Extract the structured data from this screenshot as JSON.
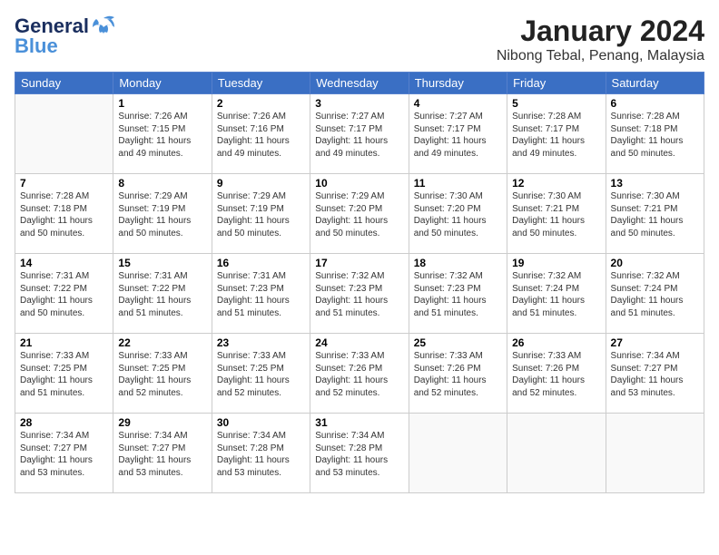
{
  "header": {
    "logo_line1": "General",
    "logo_line2": "Blue",
    "month_title": "January 2024",
    "location": "Nibong Tebal, Penang, Malaysia"
  },
  "days_of_week": [
    "Sunday",
    "Monday",
    "Tuesday",
    "Wednesday",
    "Thursday",
    "Friday",
    "Saturday"
  ],
  "weeks": [
    [
      {
        "day": "",
        "info": ""
      },
      {
        "day": "1",
        "info": "Sunrise: 7:26 AM\nSunset: 7:15 PM\nDaylight: 11 hours\nand 49 minutes."
      },
      {
        "day": "2",
        "info": "Sunrise: 7:26 AM\nSunset: 7:16 PM\nDaylight: 11 hours\nand 49 minutes."
      },
      {
        "day": "3",
        "info": "Sunrise: 7:27 AM\nSunset: 7:17 PM\nDaylight: 11 hours\nand 49 minutes."
      },
      {
        "day": "4",
        "info": "Sunrise: 7:27 AM\nSunset: 7:17 PM\nDaylight: 11 hours\nand 49 minutes."
      },
      {
        "day": "5",
        "info": "Sunrise: 7:28 AM\nSunset: 7:17 PM\nDaylight: 11 hours\nand 49 minutes."
      },
      {
        "day": "6",
        "info": "Sunrise: 7:28 AM\nSunset: 7:18 PM\nDaylight: 11 hours\nand 50 minutes."
      }
    ],
    [
      {
        "day": "7",
        "info": "Sunrise: 7:28 AM\nSunset: 7:18 PM\nDaylight: 11 hours\nand 50 minutes."
      },
      {
        "day": "8",
        "info": "Sunrise: 7:29 AM\nSunset: 7:19 PM\nDaylight: 11 hours\nand 50 minutes."
      },
      {
        "day": "9",
        "info": "Sunrise: 7:29 AM\nSunset: 7:19 PM\nDaylight: 11 hours\nand 50 minutes."
      },
      {
        "day": "10",
        "info": "Sunrise: 7:29 AM\nSunset: 7:20 PM\nDaylight: 11 hours\nand 50 minutes."
      },
      {
        "day": "11",
        "info": "Sunrise: 7:30 AM\nSunset: 7:20 PM\nDaylight: 11 hours\nand 50 minutes."
      },
      {
        "day": "12",
        "info": "Sunrise: 7:30 AM\nSunset: 7:21 PM\nDaylight: 11 hours\nand 50 minutes."
      },
      {
        "day": "13",
        "info": "Sunrise: 7:30 AM\nSunset: 7:21 PM\nDaylight: 11 hours\nand 50 minutes."
      }
    ],
    [
      {
        "day": "14",
        "info": "Sunrise: 7:31 AM\nSunset: 7:22 PM\nDaylight: 11 hours\nand 50 minutes."
      },
      {
        "day": "15",
        "info": "Sunrise: 7:31 AM\nSunset: 7:22 PM\nDaylight: 11 hours\nand 51 minutes."
      },
      {
        "day": "16",
        "info": "Sunrise: 7:31 AM\nSunset: 7:23 PM\nDaylight: 11 hours\nand 51 minutes."
      },
      {
        "day": "17",
        "info": "Sunrise: 7:32 AM\nSunset: 7:23 PM\nDaylight: 11 hours\nand 51 minutes."
      },
      {
        "day": "18",
        "info": "Sunrise: 7:32 AM\nSunset: 7:23 PM\nDaylight: 11 hours\nand 51 minutes."
      },
      {
        "day": "19",
        "info": "Sunrise: 7:32 AM\nSunset: 7:24 PM\nDaylight: 11 hours\nand 51 minutes."
      },
      {
        "day": "20",
        "info": "Sunrise: 7:32 AM\nSunset: 7:24 PM\nDaylight: 11 hours\nand 51 minutes."
      }
    ],
    [
      {
        "day": "21",
        "info": "Sunrise: 7:33 AM\nSunset: 7:25 PM\nDaylight: 11 hours\nand 51 minutes."
      },
      {
        "day": "22",
        "info": "Sunrise: 7:33 AM\nSunset: 7:25 PM\nDaylight: 11 hours\nand 52 minutes."
      },
      {
        "day": "23",
        "info": "Sunrise: 7:33 AM\nSunset: 7:25 PM\nDaylight: 11 hours\nand 52 minutes."
      },
      {
        "day": "24",
        "info": "Sunrise: 7:33 AM\nSunset: 7:26 PM\nDaylight: 11 hours\nand 52 minutes."
      },
      {
        "day": "25",
        "info": "Sunrise: 7:33 AM\nSunset: 7:26 PM\nDaylight: 11 hours\nand 52 minutes."
      },
      {
        "day": "26",
        "info": "Sunrise: 7:33 AM\nSunset: 7:26 PM\nDaylight: 11 hours\nand 52 minutes."
      },
      {
        "day": "27",
        "info": "Sunrise: 7:34 AM\nSunset: 7:27 PM\nDaylight: 11 hours\nand 53 minutes."
      }
    ],
    [
      {
        "day": "28",
        "info": "Sunrise: 7:34 AM\nSunset: 7:27 PM\nDaylight: 11 hours\nand 53 minutes."
      },
      {
        "day": "29",
        "info": "Sunrise: 7:34 AM\nSunset: 7:27 PM\nDaylight: 11 hours\nand 53 minutes."
      },
      {
        "day": "30",
        "info": "Sunrise: 7:34 AM\nSunset: 7:28 PM\nDaylight: 11 hours\nand 53 minutes."
      },
      {
        "day": "31",
        "info": "Sunrise: 7:34 AM\nSunset: 7:28 PM\nDaylight: 11 hours\nand 53 minutes."
      },
      {
        "day": "",
        "info": ""
      },
      {
        "day": "",
        "info": ""
      },
      {
        "day": "",
        "info": ""
      }
    ]
  ]
}
